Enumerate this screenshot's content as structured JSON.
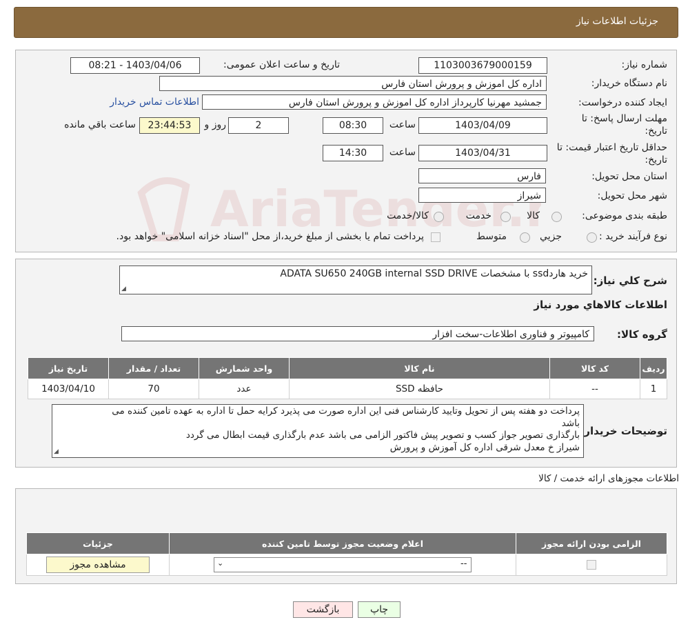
{
  "header": {
    "title": "جزئیات اطلاعات نیاز"
  },
  "form": {
    "need_number_label": "شماره نیاز:",
    "need_number": "1103003679000159",
    "announce_label": "تاریخ و ساعت اعلان عمومی:",
    "announce_value": "1403/04/06 - 08:21",
    "buyer_label": "نام دستگاه خریدار:",
    "buyer_value": "اداره کل اموزش و پرورش استان فارس",
    "creator_label": "ایجاد کننده درخواست:",
    "creator_value": "جمشید مهرنیا کارپرداز اداره کل اموزش و پرورش استان فارس",
    "contact_link": "اطلاعات تماس خریدار",
    "deadline_label_1": "مهلت ارسال پاسخ: تا",
    "deadline_label_2": "تاریخ:",
    "deadline_date": "1403/04/09",
    "time_label": "ساعت",
    "deadline_time": "08:30",
    "days_value": "2",
    "days_label": "روز و",
    "remaining_time": "23:44:53",
    "remaining_label": "ساعت باقي مانده",
    "validity_label_1": "حداقل تاریخ اعتبار قیمت: تا",
    "validity_label_2": "تاریخ:",
    "validity_date": "1403/04/31",
    "validity_time": "14:30",
    "province_label": "استان محل تحویل:",
    "province_value": "فارس",
    "city_label": "شهر محل تحویل:",
    "city_value": "شیراز",
    "category_label": "طبقه بندی موضوعی:",
    "category_options": [
      "کالا",
      "خدمت",
      "کالا/خدمت"
    ],
    "process_label": "نوع فرآیند خرید :",
    "process_options": [
      "جزیي",
      "متوسط"
    ],
    "payment_text": "پرداخت تمام یا بخشی از مبلغ خرید،از محل \"اسناد خزانه اسلامی\" خواهد بود."
  },
  "summary": {
    "desc_label": "شرح کلي نياز:",
    "desc_value": "خرید هاردssd با مشخصات ADATA SU650 240GB internal SSD DRIVE",
    "goods_info_title": "اطلاعات کالاهاي مورد نياز",
    "group_label": "گروه کالا:",
    "group_value": "کامپیوتر و فناوری اطلاعات-سخت افزار",
    "table_headers": [
      "رديف",
      "کد کالا",
      "نام کالا",
      "واحد شمارش",
      "تعداد / مقدار",
      "تاريخ نياز"
    ],
    "table_rows": [
      [
        "1",
        "--",
        "حافظه SSD",
        "عدد",
        "70",
        "1403/04/10"
      ]
    ],
    "notes_label": "توضیحات خریدار:",
    "notes_lines": [
      "پرداخت دو هفته پس از تحویل وتایید کارشناس فنی این اداره صورت می پذیرد کرایه حمل تا اداره به عهده تامین کننده می",
      "باشد",
      "بارگذاری تصویر جواز کسب و تصویر پیش فاکتور الزامی می باشد عدم بارگذاری قیمت ابطال می گردد",
      "شیراز خ معدل شرقی اداره کل آموزش و پرورش"
    ]
  },
  "permits": {
    "title": "اطلاعات مجوزهای ارائه خدمت / کالا",
    "headers": [
      "الزامی بودن ارائه مجوز",
      "اعلام وضعیت مجوز توسط تامین کننده",
      "جزئیات"
    ],
    "select_value": "--",
    "view_button": "مشاهده مجوز"
  },
  "buttons": {
    "print": "چاپ",
    "back": "بازگشت"
  },
  "watermark": {
    "text": "AriaTender.neT"
  },
  "colors": {
    "header": "#8b6a3e",
    "link": "#2850a0",
    "yellow_field": "#fcf9cc"
  }
}
